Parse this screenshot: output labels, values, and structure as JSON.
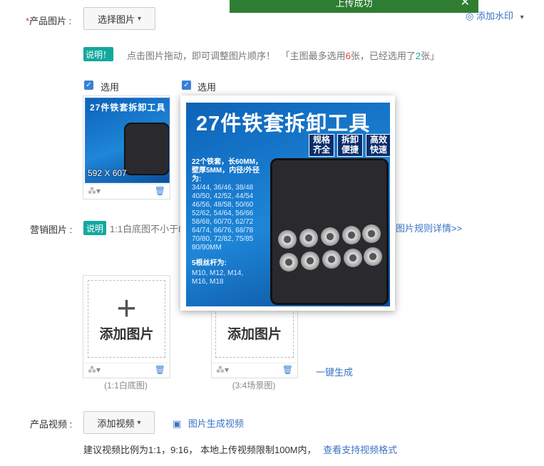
{
  "toast": {
    "message": "上传成功",
    "close": "✕"
  },
  "product_images": {
    "required_mark": "*",
    "label": "产品图片 :",
    "select_button": "选择图片",
    "watermark_link": "添加水印",
    "tip_badge": "说明！",
    "tip_text_1": "点击图片拖动，即可调整图片顺序！",
    "tip_text_2": "「主图最多选用",
    "max_count": "6",
    "tip_text_3": "张，已经选用了",
    "used_count": "2",
    "tip_text_4": "张」",
    "items": [
      {
        "checkbox_label": "选用",
        "dimensions": "592 X 607"
      },
      {
        "checkbox_label": "选用"
      }
    ]
  },
  "product_card": {
    "title": "27件铁套拆卸工具",
    "badges": [
      "规格\n齐全",
      "拆卸\n便捷",
      "高效\n快速"
    ],
    "spec_head": "22个铁套，长60MM，\n壁厚5MM，内径/外径\n为:",
    "spec_sizes": "34/44, 36/46, 38/48\n40/50, 42/52, 44/54\n46/56, 48/58, 50/60\n52/62, 54/64, 56/66\n58/68, 60/70, 62/72\n64/74, 66/76, 68/78\n70/80, 72/82, 75/85\n80/90MM",
    "rod_head": "5根丝杆为:",
    "rod_sizes": "M10, M12, M14,\nM16, M18"
  },
  "marketing_images": {
    "label": "营销图片 :",
    "tip_badge": "说明",
    "tip_text": "1:1白底图不小于8",
    "rules_link": "图片规则详情>>",
    "slots": [
      {
        "add_text": "添加图片",
        "caption": "(1:1白底图)"
      },
      {
        "add_text": "添加图片",
        "caption": "(3:4场景图)"
      }
    ],
    "one_click": "一键生成"
  },
  "video": {
    "label": "产品视频 :",
    "add_button": "添加视频",
    "generate_link": "图片生成视频",
    "note": "建议视频比例为1:1，9:16， 本地上传视频限制100M内，",
    "formats_link": "查看支持视频格式"
  },
  "icons": {
    "chevron": "⌄",
    "check": "✓",
    "wand": "⁂▾",
    "trash": "🗑",
    "plus": "+",
    "film": "▣",
    "watermark": "◎"
  }
}
